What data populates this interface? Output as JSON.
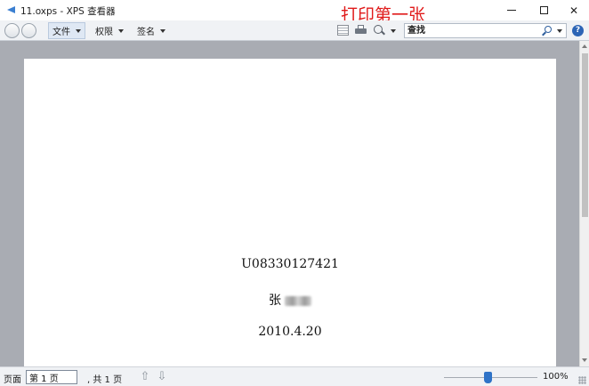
{
  "window": {
    "title": "11.oxps - XPS 查看器",
    "annotation": "打印第一张",
    "minimize_glyph": "—",
    "maximize_glyph": "☐",
    "close_glyph": "✕",
    "icon": "xps-document-icon"
  },
  "toolbar": {
    "menus": [
      {
        "label": "文件"
      },
      {
        "label": "权限"
      },
      {
        "label": "签名"
      }
    ],
    "search": {
      "value": "",
      "placeholder": "查找"
    },
    "help_glyph": "?",
    "icons": [
      "back-icon",
      "forward-icon",
      "outline-view-icon",
      "print-icon",
      "zoom-icon",
      "search-icon",
      "help-icon"
    ]
  },
  "document": {
    "lines": {
      "code": "U08330127421",
      "name": "张",
      "date": "2010.4.20"
    }
  },
  "statusbar": {
    "page_label": "页面",
    "page_value": "第 1 页",
    "page_total": ", 共 1 页",
    "prev_glyph": "⇧",
    "next_glyph": "⇩",
    "zoom_percent": "100%",
    "zoom_slider_fraction": 0.47
  },
  "colors": {
    "annotation": "#e01a1a",
    "accent": "#2f73c7",
    "viewport_bg": "#a9acb3"
  }
}
